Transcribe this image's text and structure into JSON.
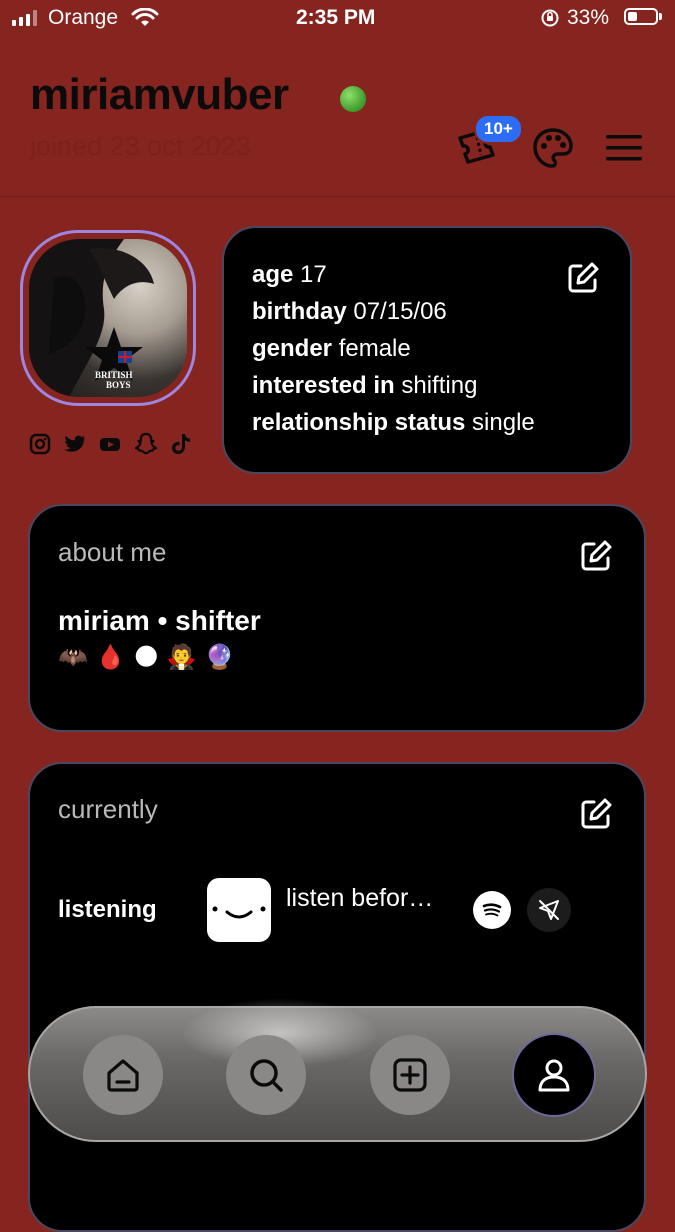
{
  "status_bar": {
    "carrier": "Orange",
    "time": "2:35 PM",
    "battery_percent": "33%"
  },
  "header": {
    "username": "miriamvuber",
    "joined": "joined 23 oct 2023",
    "tickets_badge": "10+",
    "online_color": "#4caf34"
  },
  "avatar": {
    "overlay_text_line1": "BRITISH",
    "overlay_text_line2": "BOYS"
  },
  "social_icons": [
    "instagram-icon",
    "twitter-icon",
    "youtube-icon",
    "snapchat-icon",
    "tiktok-icon"
  ],
  "info": {
    "age_label": "age",
    "age_value": "17",
    "birthday_label": "birthday",
    "birthday_value": "07/15/06",
    "gender_label": "gender",
    "gender_value": "female",
    "interested_label": "interested in",
    "interested_value": "shifting",
    "relationship_label": "relationship status",
    "relationship_value": "single"
  },
  "about": {
    "title": "about me",
    "name_line": "miriam • shifter",
    "emojis": [
      "🦇",
      "🩸",
      "🌑",
      "🧛",
      "🔮"
    ]
  },
  "currently": {
    "title": "currently",
    "listening_label": "listening",
    "track": "listen befor…"
  },
  "nav": {
    "items": [
      "home-icon",
      "search-icon",
      "add-icon",
      "profile-icon"
    ],
    "active": "profile"
  },
  "colors": {
    "background": "#86241f",
    "card": "#000000",
    "badge": "#2d6df5",
    "avatar_ring": "#9c86e0"
  }
}
